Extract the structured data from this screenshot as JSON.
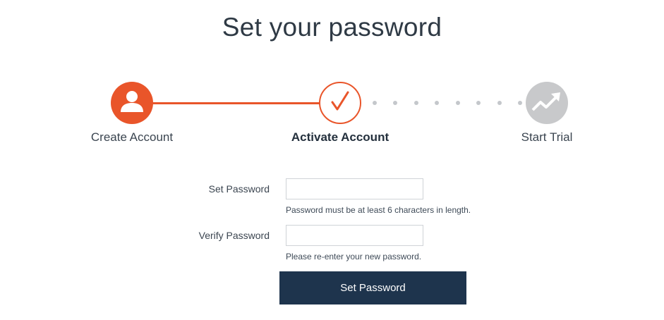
{
  "page": {
    "title": "Set your password"
  },
  "stepper": {
    "steps": [
      {
        "label": "Create Account",
        "state": "complete",
        "icon": "user-icon"
      },
      {
        "label": "Activate Account",
        "state": "current",
        "icon": "checkmark-icon"
      },
      {
        "label": "Start Trial",
        "state": "pending",
        "icon": "trend-up-icon"
      }
    ],
    "colors": {
      "accent": "#e9552a",
      "pending": "#c8c9cb"
    }
  },
  "form": {
    "set_password": {
      "label": "Set Password",
      "value": "",
      "help": "Password must be at least 6 characters in length."
    },
    "verify_password": {
      "label": "Verify Password",
      "value": "",
      "help": "Please re-enter your new password."
    },
    "submit_label": "Set Password",
    "submit_color": "#1e344d"
  }
}
